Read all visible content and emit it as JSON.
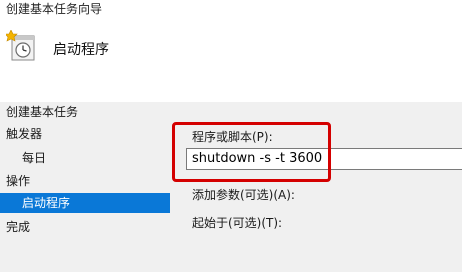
{
  "window": {
    "title": "创建基本任务向导"
  },
  "header": {
    "title": "启动程序",
    "icon": "task-clock-icon"
  },
  "nav": {
    "items": [
      {
        "label": "创建基本任务"
      },
      {
        "label": "触发器"
      },
      {
        "label": "每日"
      },
      {
        "label": "操作"
      },
      {
        "label": "启动程序"
      },
      {
        "label": "完成"
      }
    ],
    "selected": "启动程序"
  },
  "form": {
    "program_label": "程序或脚本(P):",
    "program_value": "shutdown -s -t 3600",
    "args_label": "添加参数(可选)(A):",
    "start_in_label": "起始于(可选)(T):"
  },
  "colors": {
    "selection": "#0a78d7",
    "highlight": "#d40000"
  }
}
